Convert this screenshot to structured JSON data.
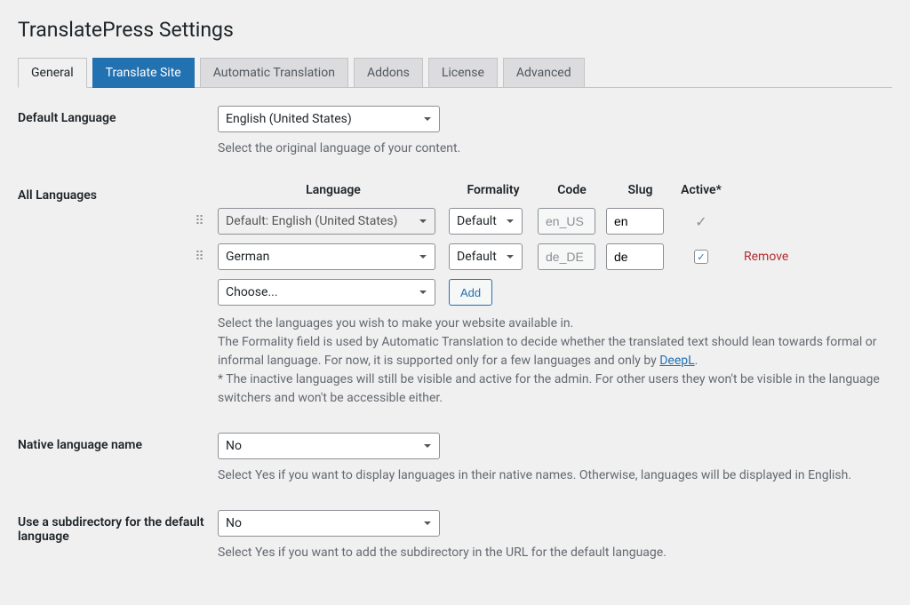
{
  "page_title": "TranslatePress Settings",
  "tabs": {
    "general": "General",
    "translate": "Translate Site",
    "auto": "Automatic Translation",
    "addons": "Addons",
    "license": "License",
    "advanced": "Advanced"
  },
  "default_language": {
    "label": "Default Language",
    "value": "English (United States)",
    "desc": "Select the original language of your content."
  },
  "all_languages": {
    "label": "All Languages",
    "headers": {
      "language": "Language",
      "formality": "Formality",
      "code": "Code",
      "slug": "Slug",
      "active": "Active*"
    },
    "rows": [
      {
        "language": "Default: English (United States)",
        "formality": "Default",
        "code": "en_US",
        "slug": "en",
        "active_check": "✓",
        "removable": false
      },
      {
        "language": "German",
        "formality": "Default",
        "code": "de_DE",
        "slug": "de",
        "active_check": "✓",
        "removable": true
      }
    ],
    "choose_placeholder": "Choose...",
    "add_label": "Add",
    "remove_label": "Remove",
    "desc1": "Select the languages you wish to make your website available in.",
    "desc2a": "The Formality field is used by Automatic Translation to decide whether the translated text should lean towards formal or informal language. For now, it is supported only for a few languages and only by ",
    "desc2_link": "DeepL",
    "desc2b": ".",
    "desc3": "* The inactive languages will still be visible and active for the admin. For other users they won't be visible in the language switchers and won't be accessible either."
  },
  "native_name": {
    "label": "Native language name",
    "value": "No",
    "desc": "Select Yes if you want to display languages in their native names. Otherwise, languages will be displayed in English."
  },
  "subdirectory": {
    "label": "Use a subdirectory for the default language",
    "value": "No",
    "desc": "Select Yes if you want to add the subdirectory in the URL for the default language."
  }
}
